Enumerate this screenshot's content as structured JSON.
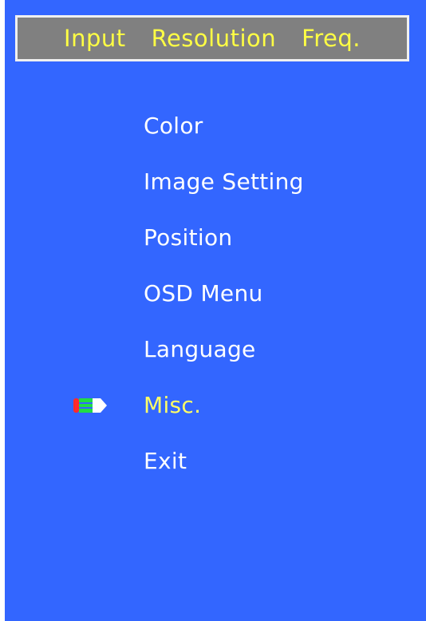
{
  "header": {
    "input_label": "Input",
    "resolution_label": "Resolution",
    "freq_label": "Freq."
  },
  "menu": {
    "items": [
      {
        "label": "Color",
        "selected": false
      },
      {
        "label": "Image Setting",
        "selected": false
      },
      {
        "label": "Position",
        "selected": false
      },
      {
        "label": "OSD Menu",
        "selected": false
      },
      {
        "label": "Language",
        "selected": false
      },
      {
        "label": "Misc.",
        "selected": true
      },
      {
        "label": "Exit",
        "selected": false
      }
    ]
  },
  "pointer": {
    "icon": "pencil-pointer-icon"
  },
  "colors": {
    "background": "#3366ff",
    "header_background": "#808080",
    "header_text": "#ffff44",
    "item_text": "#ffffff",
    "selected_text": "#ffff66"
  }
}
